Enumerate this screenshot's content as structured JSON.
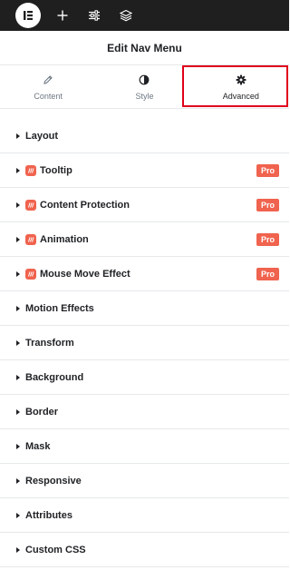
{
  "toolbar": {
    "logo_icon": "elementor-logo-icon",
    "buttons": [
      {
        "icon": "plus-icon"
      },
      {
        "icon": "sliders-icon"
      },
      {
        "icon": "layers-icon"
      }
    ]
  },
  "panel": {
    "title": "Edit Nav Menu"
  },
  "tabs": [
    {
      "label": "Content",
      "icon": "pencil-icon"
    },
    {
      "label": "Style",
      "icon": "half-circle-icon"
    },
    {
      "label": "Advanced",
      "icon": "gear-icon",
      "active": true
    }
  ],
  "highlight_color": "#e0001b",
  "pro_color": "#f0634e",
  "sections": [
    {
      "label": "Layout",
      "pro": false
    },
    {
      "label": "Tooltip",
      "pro": true,
      "badge": "Pro"
    },
    {
      "label": "Content Protection",
      "pro": true,
      "badge": "Pro"
    },
    {
      "label": "Animation",
      "pro": true,
      "badge": "Pro"
    },
    {
      "label": "Mouse Move Effect",
      "pro": true,
      "badge": "Pro"
    },
    {
      "label": "Motion Effects",
      "pro": false
    },
    {
      "label": "Transform",
      "pro": false
    },
    {
      "label": "Background",
      "pro": false
    },
    {
      "label": "Border",
      "pro": false
    },
    {
      "label": "Mask",
      "pro": false
    },
    {
      "label": "Responsive",
      "pro": false
    },
    {
      "label": "Attributes",
      "pro": false
    },
    {
      "label": "Custom CSS",
      "pro": false
    }
  ]
}
